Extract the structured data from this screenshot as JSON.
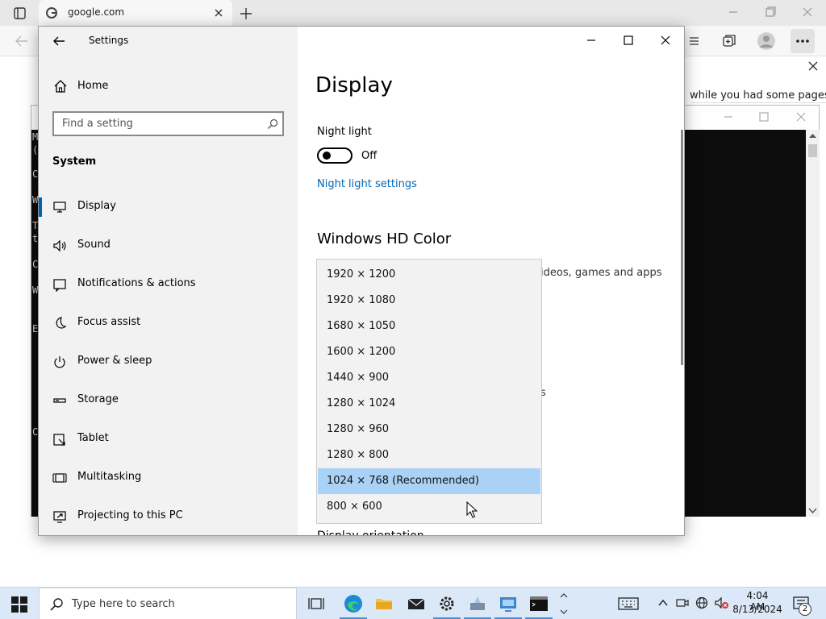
{
  "browser": {
    "tab_title": "google.com",
    "infobar_text": "while you had some pages"
  },
  "console": {
    "visible_chars": [
      "M",
      "(",
      "C",
      "W",
      "T",
      "t",
      "C",
      "W",
      "E",
      "C"
    ]
  },
  "settings": {
    "window_title": "Settings",
    "home_label": "Home",
    "search_placeholder": "Find a setting",
    "section_label": "System",
    "nav": [
      {
        "label": "Display",
        "icon": "display-icon",
        "selected": true
      },
      {
        "label": "Sound",
        "icon": "sound-icon"
      },
      {
        "label": "Notifications & actions",
        "icon": "notifications-icon"
      },
      {
        "label": "Focus assist",
        "icon": "focus-assist-icon"
      },
      {
        "label": "Power & sleep",
        "icon": "power-icon"
      },
      {
        "label": "Storage",
        "icon": "storage-icon"
      },
      {
        "label": "Tablet",
        "icon": "tablet-icon"
      },
      {
        "label": "Multitasking",
        "icon": "multitasking-icon"
      },
      {
        "label": "Projecting to this PC",
        "icon": "projecting-icon"
      }
    ],
    "page_title": "Display",
    "night_light": {
      "label": "Night light",
      "state": "Off",
      "link": "Night light settings"
    },
    "hd_color": {
      "heading": "Windows HD Color",
      "desc_fragment": "ideos, games and apps",
      "below_fragment": "s"
    },
    "orientation_label": "Display orientation",
    "resolution_options": [
      "1920 × 1200",
      "1920 × 1080",
      "1680 × 1050",
      "1600 × 1200",
      "1440 × 900",
      "1280 × 1024",
      "1280 × 960",
      "1280 × 800",
      "1024 × 768 (Recommended)",
      "800 × 600"
    ],
    "selected_resolution": "1024 × 768 (Recommended)"
  },
  "taskbar": {
    "search_placeholder": "Type here to search",
    "time": "4:04 AM",
    "date": "8/13/2024",
    "notification_count": "2"
  },
  "colors": {
    "accent": "#0063b1",
    "link": "#0067b8",
    "selected_option": "#a9d2f6",
    "taskbar": "#dbe8f7"
  }
}
